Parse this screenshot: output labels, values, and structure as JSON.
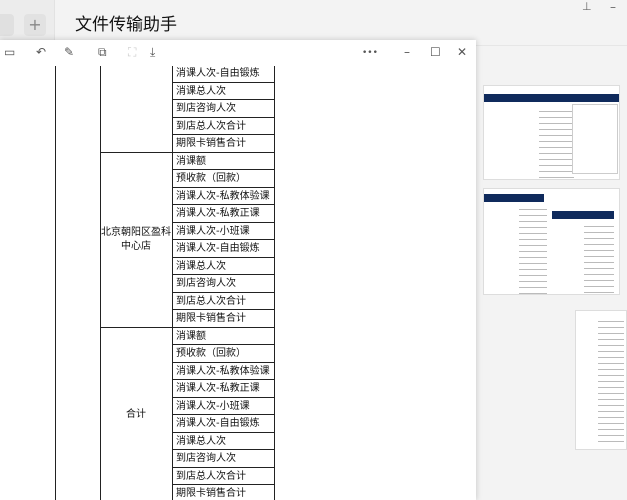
{
  "window": {
    "title": "文件传输助手",
    "add_tab": "+",
    "pin_icon": "pin-icon",
    "minimize": "–"
  },
  "viewer": {
    "toolbar": {
      "more": "•••",
      "minimize": "–",
      "maximize": "☐",
      "close": "✕"
    },
    "partial_top_row": "消课人次-自由锻炼",
    "groups": [
      {
        "name": "",
        "rows": [
          "消课总人次",
          "到店咨询人次",
          "到店总人次合计",
          "期限卡销售合计"
        ]
      },
      {
        "name": "北京朝阳区盈科中心店",
        "rows": [
          "消课额",
          "预收款（回款）",
          "消课人次-私教体验课",
          "消课人次-私教正课",
          "消课人次-小班课",
          "消课人次-自由锻炼",
          "消课总人次",
          "到店咨询人次",
          "到店总人次合计",
          "期限卡销售合计"
        ]
      },
      {
        "name": "合计",
        "rows": [
          "消课额",
          "预收款（回款）",
          "消课人次-私教体验课",
          "消课人次-私教正课",
          "消课人次-小班课",
          "消课人次-自由锻炼",
          "消课总人次",
          "到店咨询人次",
          "到店总人次合计",
          "期限卡销售合计"
        ]
      }
    ]
  }
}
